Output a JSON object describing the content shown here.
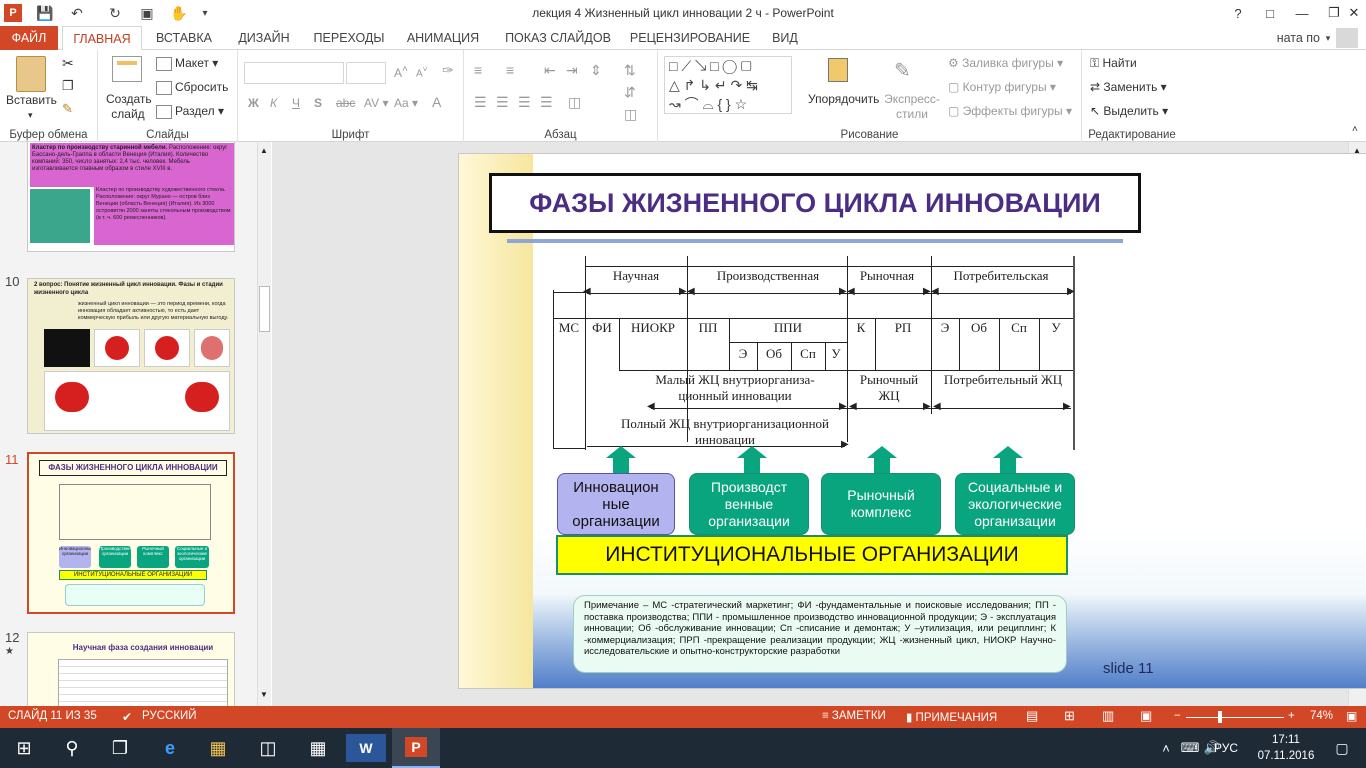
{
  "window": {
    "title": "лекция 4 Жизненный цикл инновации 2 ч - PowerPoint",
    "help": "?",
    "user": "ната по"
  },
  "tabs": [
    "ФАЙЛ",
    "ГЛАВНАЯ",
    "ВСТАВКА",
    "ДИЗАЙН",
    "ПЕРЕХОДЫ",
    "АНИМАЦИЯ",
    "ПОКАЗ СЛАЙДОВ",
    "РЕЦЕНЗИРОВАНИЕ",
    "ВИД"
  ],
  "ribbon": {
    "clipboard": {
      "paste": "Вставить",
      "label": "Буфер обмена"
    },
    "slides": {
      "new_slide": "Создать слайд",
      "layout": "Макет",
      "reset": "Сбросить",
      "section": "Раздел",
      "label": "Слайды"
    },
    "font": {
      "label": "Шрифт",
      "bold": "Ж",
      "italic": "К",
      "underline": "Ч",
      "strike": "S",
      "abc": "abc",
      "spacing": "AV",
      "case": "Aa",
      "grow": "A",
      "shrink": "A"
    },
    "paragraph": {
      "label": "Абзац"
    },
    "drawing": {
      "arrange": "Упорядочить",
      "quick_styles": "Экспресс-стили",
      "fill": "Заливка фигуры",
      "outline": "Контур фигуры",
      "effects": "Эффекты фигуры",
      "label": "Рисование"
    },
    "editing": {
      "find": "Найти",
      "replace": "Заменить",
      "select": "Выделить",
      "label": "Редактирование"
    }
  },
  "thumbnails": [
    {
      "num": "10",
      "title": "2 вопрос: Понятие жизненный цикл инновации. Фазы и стадии жизненного цикла"
    },
    {
      "num": "11",
      "title": "ФАЗЫ ЖИЗНЕННОГО ЦИКЛА ИННОВАЦИИ",
      "boxes": [
        "Инновационные организации",
        "Производственные организации",
        "Рыночный комплекс",
        "Социальные и экологические организации"
      ],
      "bottom": "ИНСТИТУЦИОНАЛЬНЫЕ ОРГАНИЗАЦИИ"
    },
    {
      "num": "12",
      "title": "Научная фаза создания инновации",
      "star": "★"
    }
  ],
  "thumb9": {
    "text1": "Кластер по производству старинной мебели.",
    "text2": "Расположение: округ Бассано-дель-Граппа в области Венеция (Италия). Количество компаний: 350, число занятых: 2,4 тыс. человек. Мебель изготавливается главным образом в стиле XVIII в.",
    "text3": "Кластер по производству художественного стекла. Расположение: округ Мурано — остров близ Венеции (область Венеция) (Италия). Из 3000 островитян 2000 заняты стекольным производством (в т. ч. 600 ремесленников)."
  },
  "thumb10": {
    "text": "жизненный цикл инновации — это период времени, когда инновация обладает активностью, то есть дает коммерческую прибыль или другую материальную выгоду."
  },
  "slide": {
    "title": "ФАЗЫ ЖИЗНЕННОГО ЦИКЛА ИННОВАЦИИ",
    "phases": [
      "Научная",
      "Производственная",
      "Рыночная",
      "Потребительская"
    ],
    "stages": [
      "МС",
      "ФИ",
      "НИОКР",
      "ПП",
      "ППИ",
      "К",
      "РП",
      "Э",
      "Об",
      "Сп",
      "У"
    ],
    "substages": [
      "Э",
      "Об",
      "Сп",
      "У"
    ],
    "small_cycle": "Малый ЖЦ внутриорганиза-ционный инновации",
    "market_cycle": "Рыночный ЖЦ",
    "consumer_cycle": "Потребительный ЖЦ",
    "full_cycle": "Полный ЖЦ внутриорганизационной инновации",
    "boxes": [
      "Инновацион ные организации",
      "Производст венные организации",
      "Рыночный комплекс",
      "Социальные и экологические организации"
    ],
    "institutional": "ИНСТИТУЦИОНАЛЬНЫЕ ОРГАНИЗАЦИИ",
    "note": "Примечание – МС -стратегический маркетинг; ФИ -фундаментальные и поисковые исследования; ПП - поставка производства; ППИ - промышленное производство инновационной продукции; Э - эксплуатация инновации; Об -обслуживание инновации; Сп -списание и демонтаж; У –утилизация, или рециплинг; К -коммерциализация; ПРП -прекращение реализации продукции; ЖЦ -жизненный цикл, НИОКР Научно-исследовательские и опытно-конструкторские разработки",
    "slide_label": "slide 11"
  },
  "status": {
    "slide": "СЛАЙД 11 ИЗ 35",
    "lang": "РУССКИЙ",
    "notes": "ЗАМЕТКИ",
    "comments": "ПРИМЕЧАНИЯ",
    "zoom": "74%"
  },
  "taskbar": {
    "lang": "РУС",
    "time": "17:11",
    "date": "07.11.2016"
  },
  "colors": {
    "accent": "#d24726",
    "title": "#4b2e83",
    "teal": "#08a57f",
    "yellow": "#ffff00",
    "lavender": "#b3b3f0"
  }
}
